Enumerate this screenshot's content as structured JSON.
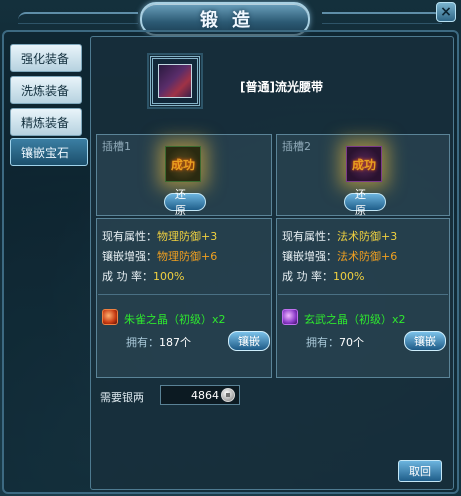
{
  "window": {
    "title": "锻造",
    "close_glyph": "×"
  },
  "tabs": [
    {
      "label": "强化装备"
    },
    {
      "label": "洗炼装备"
    },
    {
      "label": "精炼装备"
    },
    {
      "label": "镶嵌宝石",
      "active": true
    }
  ],
  "item": {
    "name": "[普通]流光腰带",
    "icon": "purple-belt-icon"
  },
  "slots": [
    {
      "title": "插槽1",
      "gem_seal": "成功",
      "restore_label": "还原",
      "attrs": [
        {
          "key": "现有属性：",
          "value": "物理防御+3"
        },
        {
          "key": "镶嵌增强：",
          "value": "物理防御+6"
        },
        {
          "key": "成 功 率：",
          "value": "100%"
        }
      ],
      "material": {
        "name": "朱雀之晶（初级）x2",
        "color": "#2ee82e",
        "icon": "red-crystal-icon"
      },
      "owned_label": "拥有：",
      "owned_value": "187个",
      "embed_label": "镶嵌"
    },
    {
      "title": "插槽2",
      "gem_seal": "成功",
      "restore_label": "还原",
      "attrs": [
        {
          "key": "现有属性：",
          "value": "法术防御+3"
        },
        {
          "key": "镶嵌增强：",
          "value": "法术防御+6"
        },
        {
          "key": "成 功 率：",
          "value": "100%"
        }
      ],
      "material": {
        "name": "玄武之晶（初级）x2",
        "color": "#2ee82e",
        "icon": "purple-crystal-icon"
      },
      "owned_label": "拥有：",
      "owned_value": "70个",
      "embed_label": "镶嵌"
    }
  ],
  "cost": {
    "label": "需要银两",
    "value": "4864",
    "icon": "silver-coin-icon"
  },
  "back_label": "取回",
  "colors": {
    "accent": "#2b6f96",
    "value_yellow": "#f0d040",
    "value_green": "#2ee82e"
  }
}
